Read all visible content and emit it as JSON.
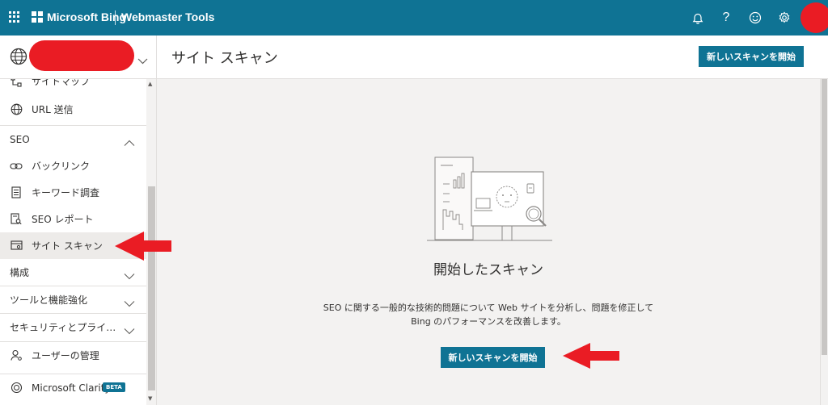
{
  "header": {
    "brand": "Microsoft Bing",
    "product": "Webmaster Tools",
    "help_glyph": "?",
    "icons": [
      "apps-grid-icon",
      "microsoft-logo-icon",
      "bell-icon",
      "help-icon",
      "smiley-feedback-icon",
      "gear-icon"
    ]
  },
  "sidebar": {
    "items": [
      {
        "label": "サイトマップ",
        "icon": "sitemap-icon"
      },
      {
        "label": "URL 送信",
        "icon": "globe-icon"
      }
    ],
    "seo_group": {
      "label": "SEO",
      "items": [
        {
          "label": "バックリンク",
          "icon": "link-icon"
        },
        {
          "label": "キーワード調査",
          "icon": "document-icon"
        },
        {
          "label": "SEO レポート",
          "icon": "report-icon"
        },
        {
          "label": "サイト スキャン",
          "icon": "scan-icon",
          "active": true
        }
      ]
    },
    "groups": [
      {
        "label": "構成"
      },
      {
        "label": "ツールと機能強化"
      },
      {
        "label": "セキュリティとプライ…"
      }
    ],
    "bottom_items": [
      {
        "label": "ユーザーの管理",
        "icon": "user-settings-icon"
      },
      {
        "label": "Microsoft Clarity",
        "icon": "clarity-icon",
        "badge": "BETA"
      }
    ]
  },
  "main": {
    "title": "サイト スキャン",
    "new_scan_button": "新しいスキャンを開始",
    "empty": {
      "title": "開始したスキャン",
      "description": "SEO に関する一般的な技術的問題について Web サイトを分析し、問題を修正して Bing のパフォーマンスを改善します。",
      "button": "新しいスキャンを開始"
    }
  },
  "colors": {
    "brand_teal": "#0f7394",
    "annotation_red": "#ea1c24",
    "sidebar_active": "#edebe9",
    "content_bg": "#f3f2f1"
  }
}
